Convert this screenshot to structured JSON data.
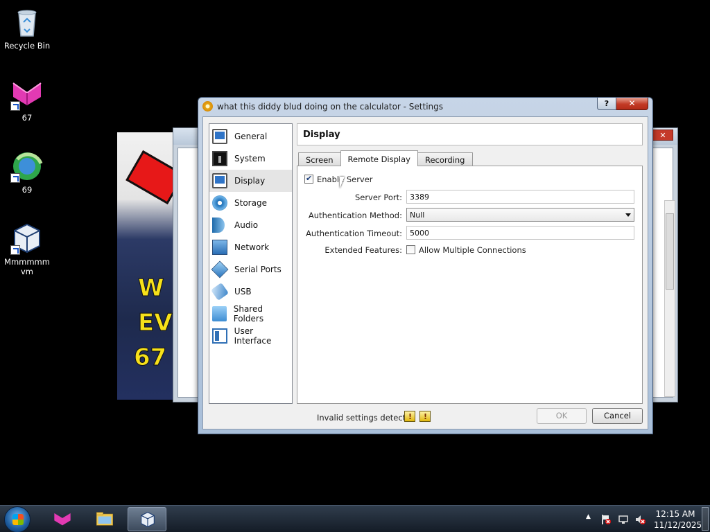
{
  "desktop": {
    "icons": [
      {
        "label": "Recycle Bin"
      },
      {
        "label": "67"
      },
      {
        "label": "69"
      },
      {
        "label": "Mmmmmm\nvm"
      }
    ]
  },
  "background_window": {
    "close_label": "✕",
    "thumbnail_text": [
      "W",
      "EV",
      "67"
    ]
  },
  "dialog": {
    "title": "what this diddy blud doing on the calculator - Settings",
    "help_label": "?",
    "close_label": "✕",
    "sidebar": [
      {
        "label": "General",
        "icon": "monitor-icon"
      },
      {
        "label": "System",
        "icon": "motherboard-icon"
      },
      {
        "label": "Display",
        "icon": "display-icon",
        "active": true
      },
      {
        "label": "Storage",
        "icon": "disk-icon"
      },
      {
        "label": "Audio",
        "icon": "speaker-icon"
      },
      {
        "label": "Network",
        "icon": "network-icon"
      },
      {
        "label": "Serial Ports",
        "icon": "serial-port-icon"
      },
      {
        "label": "USB",
        "icon": "usb-icon"
      },
      {
        "label": "Shared Folders",
        "icon": "folder-icon"
      },
      {
        "label": "User Interface",
        "icon": "user-interface-icon"
      }
    ],
    "section_title": "Display",
    "tabs": [
      {
        "label": "Screen"
      },
      {
        "label": "Remote Display",
        "active": true
      },
      {
        "label": "Recording"
      }
    ],
    "remote_display": {
      "enable_server_label": "Enable Server",
      "enable_server_checked": true,
      "server_port_label": "Server Port:",
      "server_port_value": "3389",
      "auth_method_label": "Authentication Method:",
      "auth_method_value": "Null",
      "auth_timeout_label": "Authentication Timeout:",
      "auth_timeout_value": "5000",
      "extended_features_label": "Extended Features:",
      "allow_multiple_label": "Allow Multiple Connections",
      "allow_multiple_checked": false
    },
    "invalid_settings_text": "Invalid settings detected",
    "ok_label": "OK",
    "cancel_label": "Cancel"
  },
  "taskbar": {
    "time": "12:15 AM",
    "date": "11/12/2025",
    "tray_arrow": "▲"
  },
  "colors": {
    "accent_blue": "#2f74c7",
    "close_red": "#c33b26",
    "taskbar": "#1c2633"
  }
}
